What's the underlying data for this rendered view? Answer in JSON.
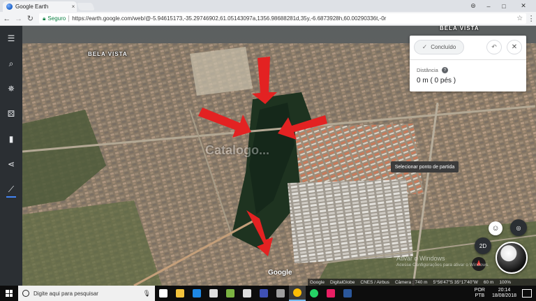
{
  "browser": {
    "tab_title": "Google Earth",
    "tab_close": "×",
    "secure_label": "Seguro",
    "url": "https://earth.google.com/web/@-5.94615173,-35.29746902,61.05143097a,1356.98688281d,35y,-6.6873928h,60.00290336t,-0r",
    "window_controls": [
      "–",
      "□",
      "✕"
    ],
    "account_glyph": "⊜"
  },
  "sidebar": {
    "items": [
      {
        "icon": "menu-icon",
        "glyph": "☰"
      },
      {
        "icon": "search-icon",
        "glyph": "⌕"
      },
      {
        "icon": "voyager-icon",
        "glyph": "✵"
      },
      {
        "icon": "feeling-lucky-icon",
        "glyph": "⚄"
      },
      {
        "icon": "bookmark-icon",
        "glyph": "▮"
      },
      {
        "icon": "share-icon",
        "glyph": "⋖"
      },
      {
        "icon": "measure-icon",
        "glyph": "⟋"
      }
    ]
  },
  "map": {
    "place_labels": [
      "BELA VISTA",
      "BELA VISTA"
    ],
    "watermark": "Catalogo...",
    "tooltip": "Selecionar ponto de partida",
    "google_logo": "Google",
    "attribution": [
      "Google",
      "DigitalGlobe",
      "CNES / Airbus"
    ],
    "camera": "Câmera : 740 m",
    "coords": "5°56'47\"S 35°17'40\"W",
    "altitude": "60 m",
    "zoom_pct": "100%",
    "view_mode": "2D",
    "activate_windows": {
      "line1": "Ativar o Windows",
      "line2": "Acesse Configurações para ativar o Windows."
    }
  },
  "measure_panel": {
    "done_label": "Concluído",
    "distance_label": "Distância",
    "help_glyph": "?",
    "distance_value": "0 m ( 0 pés )"
  },
  "taskbar": {
    "search_placeholder": "Digite aqui para pesquisar",
    "lang_line1": "POR",
    "lang_line2": "PTB",
    "time": "20:14",
    "date": "18/08/2018",
    "apps": [
      {
        "icon": "task-view-icon",
        "color": "#ffffff"
      },
      {
        "icon": "file-explorer-icon",
        "color": "#f3c33c"
      },
      {
        "icon": "edge-icon",
        "color": "#1e88e5"
      },
      {
        "icon": "store-icon",
        "color": "#e0e0e0"
      },
      {
        "icon": "photos-icon",
        "color": "#7cb342"
      },
      {
        "icon": "calculator-icon",
        "color": "#dddddd"
      },
      {
        "icon": "network-app-icon",
        "color": "#3f51b5"
      },
      {
        "icon": "photos-viewer-icon",
        "color": "#9e9e9e"
      },
      {
        "icon": "chrome-icon",
        "color": "#fbbc05"
      },
      {
        "icon": "whatsapp-icon",
        "color": "#25d366"
      },
      {
        "icon": "maps-app-icon",
        "color": "#e91e63"
      },
      {
        "icon": "word-icon",
        "color": "#2b579a"
      }
    ]
  }
}
